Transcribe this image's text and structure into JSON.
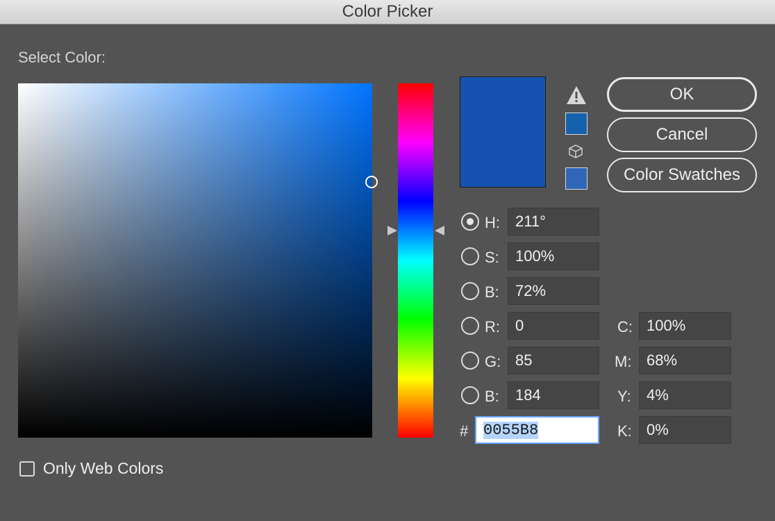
{
  "window": {
    "title": "Color Picker"
  },
  "select_label": "Select Color:",
  "colors": {
    "new_color": "#1752b0",
    "gamut_swatch": "#1462ad",
    "web_safe_swatch": "#2f66b8"
  },
  "icons": {
    "gamut_warning": "warning-triangle-icon",
    "web_safe": "cube-icon"
  },
  "buttons": {
    "ok": "OK",
    "cancel": "Cancel",
    "swatches": "Color Swatches"
  },
  "fields": {
    "h": {
      "label": "H:",
      "value": "211°",
      "selected": true
    },
    "s": {
      "label": "S:",
      "value": "100%"
    },
    "bri": {
      "label": "B:",
      "value": "72%"
    },
    "r": {
      "label": "R:",
      "value": "0"
    },
    "g": {
      "label": "G:",
      "value": "85"
    },
    "b": {
      "label": "B:",
      "value": "184"
    },
    "c": {
      "label": "C:",
      "value": "100%"
    },
    "m": {
      "label": "M:",
      "value": "68%"
    },
    "y": {
      "label": "Y:",
      "value": "4%"
    },
    "k": {
      "label": "K:",
      "value": "0%"
    }
  },
  "hex": {
    "label": "#",
    "value": "0055B8"
  },
  "only_web_colors": {
    "label": "Only Web Colors",
    "checked": false
  }
}
